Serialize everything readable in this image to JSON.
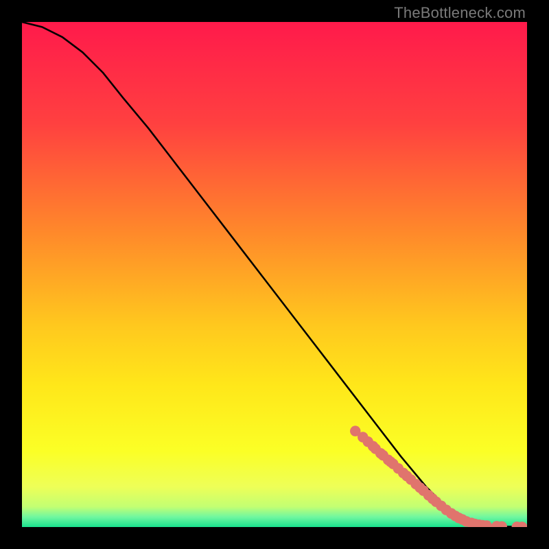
{
  "watermark": "TheBottleneck.com",
  "colors": {
    "frame": "#000000",
    "curve": "#000000",
    "dots": "#e0746d",
    "gradient_stops": [
      {
        "pct": 0,
        "color": "#ff1a4b"
      },
      {
        "pct": 20,
        "color": "#ff4040"
      },
      {
        "pct": 42,
        "color": "#ff8a2a"
      },
      {
        "pct": 60,
        "color": "#ffc81e"
      },
      {
        "pct": 72,
        "color": "#ffe71a"
      },
      {
        "pct": 85,
        "color": "#fbff26"
      },
      {
        "pct": 92,
        "color": "#eeff57"
      },
      {
        "pct": 96,
        "color": "#c2ff73"
      },
      {
        "pct": 98,
        "color": "#70f7a0"
      },
      {
        "pct": 100,
        "color": "#19e28e"
      }
    ]
  },
  "chart_data": {
    "type": "line",
    "title": "",
    "xlabel": "",
    "ylabel": "",
    "xlim": [
      0,
      100
    ],
    "ylim": [
      0,
      100
    ],
    "series": [
      {
        "name": "curve",
        "x": [
          0,
          4,
          8,
          12,
          16,
          20,
          25,
          30,
          35,
          40,
          45,
          50,
          55,
          60,
          65,
          70,
          75,
          80,
          83,
          86,
          88,
          90,
          92,
          94,
          96,
          98,
          100
        ],
        "y": [
          100,
          99,
          97,
          94,
          90,
          85,
          79,
          72.5,
          66,
          59.5,
          53,
          46.5,
          40,
          33.5,
          27,
          20.5,
          14,
          8,
          5,
          2.5,
          1.5,
          0.8,
          0.4,
          0.2,
          0.1,
          0.05,
          0
        ]
      }
    ],
    "highlight_points": {
      "name": "flat-region-dots",
      "x": [
        66,
        67.5,
        68.5,
        69.5,
        70,
        71,
        71.5,
        72.5,
        73,
        73.5,
        74.5,
        75.5,
        76.2,
        77,
        78,
        78.8,
        79.5,
        80.5,
        81.3,
        82,
        83,
        84,
        85,
        85.8,
        86.5,
        87.2,
        88,
        89,
        89.7,
        90.5,
        91.2,
        92,
        94,
        95,
        98,
        99
      ],
      "y": [
        19,
        17.8,
        16.9,
        16,
        15.5,
        14.6,
        14.2,
        13.3,
        12.9,
        12.5,
        11.6,
        10.7,
        10.1,
        9.4,
        8.5,
        7.8,
        7.2,
        6.3,
        5.6,
        5,
        4.2,
        3.4,
        2.7,
        2.2,
        1.8,
        1.5,
        1.1,
        0.8,
        0.6,
        0.45,
        0.35,
        0.28,
        0.15,
        0.1,
        0.03,
        0.02
      ]
    }
  }
}
